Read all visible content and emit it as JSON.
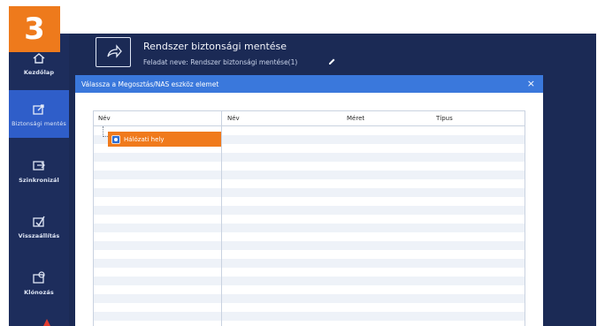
{
  "step_number": "3",
  "sidebar": {
    "items": [
      {
        "label": "Kezdőlap",
        "icon": "home-icon"
      },
      {
        "label": "Biztonsági mentés",
        "icon": "backup-icon"
      },
      {
        "label": "Szinkronizál",
        "icon": "sync-icon"
      },
      {
        "label": "Visszaállítás",
        "icon": "restore-icon"
      },
      {
        "label": "Klónozás",
        "icon": "clone-icon"
      }
    ]
  },
  "header": {
    "title": "Rendszer biztonsági mentése",
    "task_name": "Feladat neve:  Rendszer biztonsági mentése(1)"
  },
  "dialog": {
    "title": "Válassza a Megosztás/NAS eszköz elemet",
    "close_symbol": "×",
    "left_panel": {
      "header": "Név",
      "items": [
        {
          "label": "Hálózati hely",
          "selected": true
        }
      ]
    },
    "right_panel": {
      "columns": [
        "Név",
        "Méret",
        "Típus"
      ]
    }
  },
  "colors": {
    "accent_orange": "#f07a1c",
    "app_background": "#1b2a55",
    "dialog_titlebar": "#3a78dc",
    "sidebar_active": "#2f5ec9"
  }
}
